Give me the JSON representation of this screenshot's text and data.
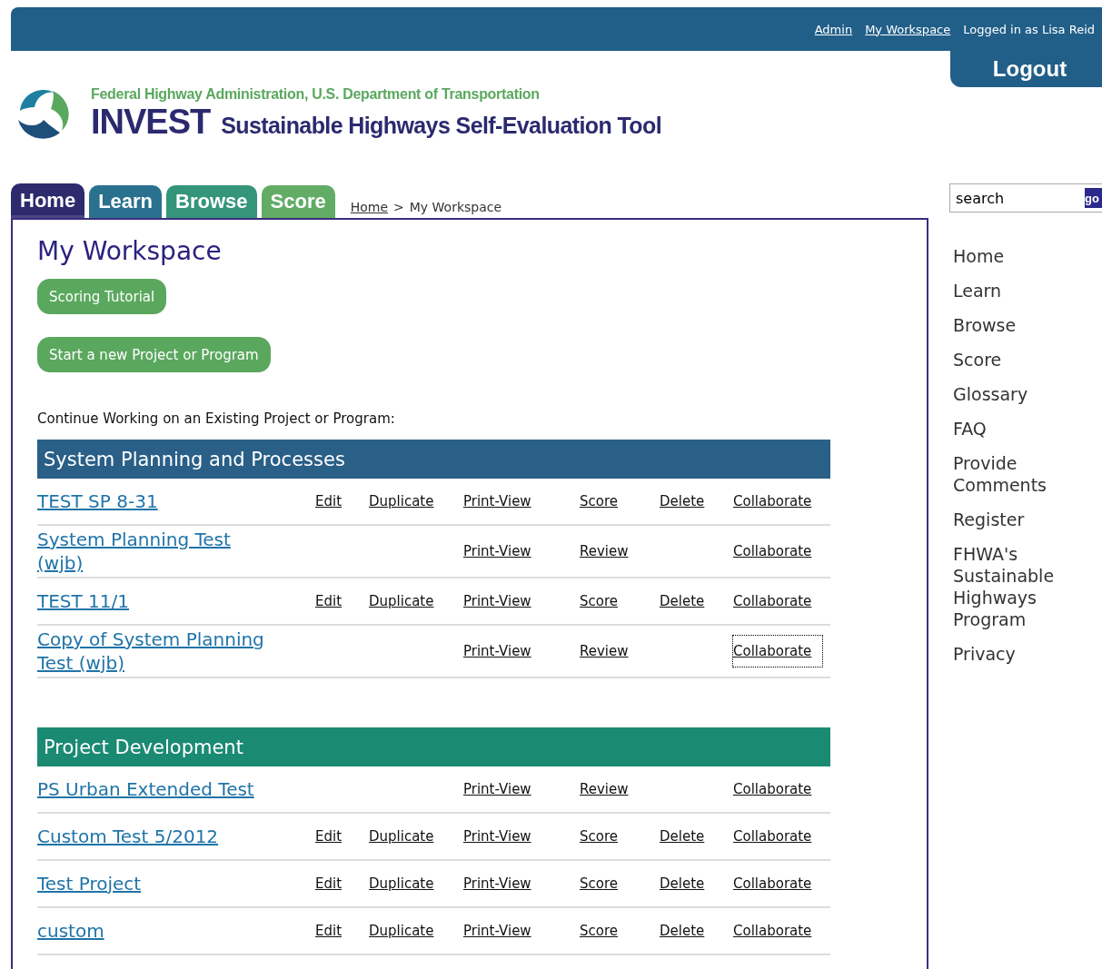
{
  "top_bar": {
    "links": [
      "Admin",
      "My Workspace"
    ],
    "user": "Logged in as Lisa Reid",
    "logout": "Logout"
  },
  "header": {
    "agency": "Federal Highway Administration, U.S. Department of Transportation",
    "product": "INVEST",
    "subtitle": "Sustainable Highways Self-Evaluation Tool"
  },
  "tabs": [
    {
      "label": "Home",
      "selected": true,
      "color": "#2e2a6e"
    },
    {
      "label": "Learn",
      "selected": false,
      "color": "#1f6a8a"
    },
    {
      "label": "Browse",
      "selected": false,
      "color": "#2a9073"
    },
    {
      "label": "Score",
      "selected": false,
      "color": "#5aa85e"
    }
  ],
  "breadcrumb": {
    "link": "Home",
    "separator": ">",
    "current": "My Workspace"
  },
  "search": {
    "value": "search",
    "button": "go"
  },
  "title": "My Workspace",
  "buttons": [
    "Scoring Tutorial",
    "Start a new Project or Program"
  ],
  "intro": "Continue Working on an Existing Project or Program:",
  "sections": [
    {
      "title": "System Planning and Processes",
      "color": "#2a5f87",
      "rows": [
        {
          "name": "TEST SP 8-31",
          "edit": "Edit",
          "duplicate": "Duplicate",
          "print_view": "Print-View",
          "score": "Score",
          "delete": "Delete",
          "collaborate": "Collaborate",
          "focused": false
        },
        {
          "name": "System Planning Test (wjb)",
          "print_view": "Print-View",
          "score": "Review",
          "collaborate": "Collaborate",
          "focused": false
        },
        {
          "name": "TEST 11/1",
          "edit": "Edit",
          "duplicate": "Duplicate",
          "print_view": "Print-View",
          "score": "Score",
          "delete": "Delete",
          "collaborate": "Collaborate",
          "focused": false
        },
        {
          "name": "Copy of System Planning Test (wjb)",
          "print_view": "Print-View",
          "score": "Review",
          "collaborate": "Collaborate",
          "focused": true
        }
      ]
    },
    {
      "title": "Project Development",
      "color": "#1b8a73",
      "rows": [
        {
          "name": "PS Urban Extended Test",
          "print_view": "Print-View",
          "score": "Review",
          "collaborate": "Collaborate",
          "focused": false
        },
        {
          "name": "Custom Test 5/2012",
          "edit": "Edit",
          "duplicate": "Duplicate",
          "print_view": "Print-View",
          "score": "Score",
          "delete": "Delete",
          "collaborate": "Collaborate",
          "focused": false
        },
        {
          "name": "Test Project",
          "edit": "Edit",
          "duplicate": "Duplicate",
          "print_view": "Print-View",
          "score": "Score",
          "delete": "Delete",
          "collaborate": "Collaborate",
          "focused": false
        },
        {
          "name": "custom",
          "edit": "Edit",
          "duplicate": "Duplicate",
          "print_view": "Print-View",
          "score": "Score",
          "delete": "Delete",
          "collaborate": "Collaborate",
          "focused": false
        }
      ]
    }
  ],
  "sidebar": {
    "items": [
      "Home",
      "Learn",
      "Browse",
      "Score",
      "Glossary",
      "FAQ",
      "Provide Comments",
      "Register",
      "FHWA's Sustainable Highways Program",
      "Privacy"
    ]
  }
}
